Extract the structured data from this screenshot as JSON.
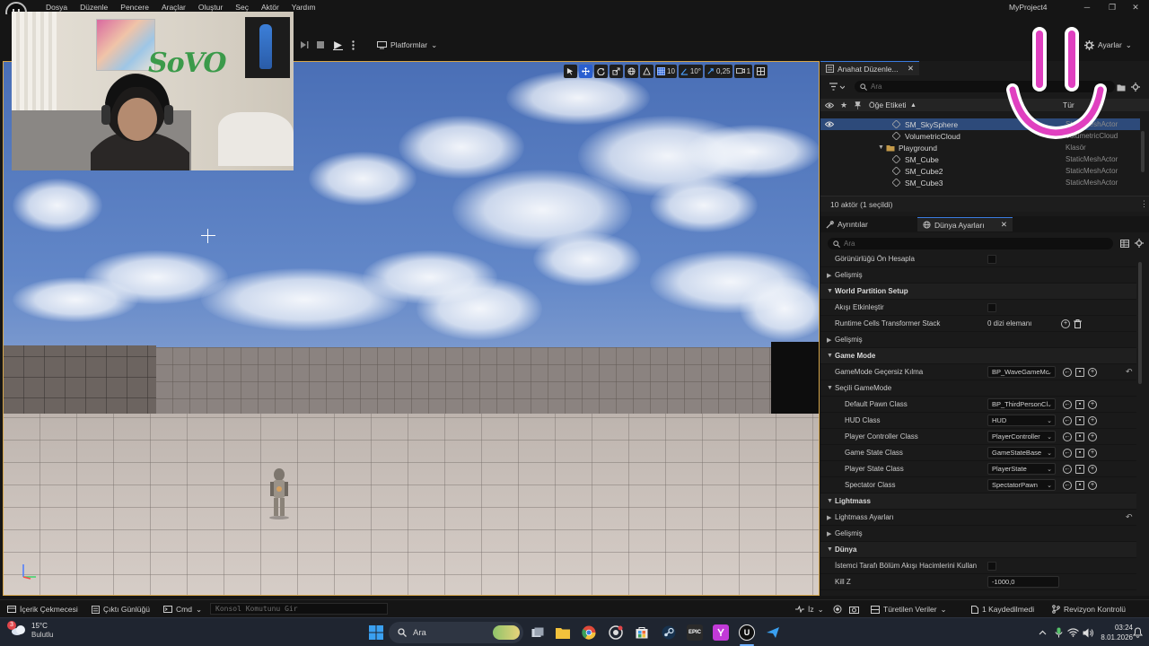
{
  "menu": {
    "logo": "U",
    "items": [
      "Dosya",
      "Düzenle",
      "Pencere",
      "Araçlar",
      "Oluştur",
      "Seç",
      "Aktör",
      "Yardım"
    ],
    "project_title": "MyProject4",
    "minimize": "─",
    "maximize": "❐",
    "close": "✕"
  },
  "toolbar": {
    "platforms_label": "Platformlar",
    "settings_label": "Ayarlar",
    "chevron": "⌄"
  },
  "viewport_toolbar": {
    "grid_snap_value": "10",
    "rotation_snap_value": "10°",
    "scale_snap_value": "0,25",
    "camera_speed_value": "1"
  },
  "webcam": {
    "graffiti_text": "SoVO"
  },
  "outliner": {
    "tab_label": "Anahat Düzenle...",
    "close_symbol": "✕",
    "search_placeholder": "Ara",
    "col_label": "Öğe Etiketi",
    "col_type": "Tür",
    "rows": [
      {
        "label": "SM_SkySphere",
        "type": "StaticMeshActor"
      },
      {
        "label": "VolumetricCloud",
        "type": "VolumetricCloud"
      },
      {
        "label": "Playground",
        "type": "Klasör"
      },
      {
        "label": "SM_Cube",
        "type": "StaticMeshActor"
      },
      {
        "label": "SM_Cube2",
        "type": "StaticMeshActor"
      },
      {
        "label": "SM_Cube3",
        "type": "StaticMeshActor"
      }
    ],
    "status": "10 aktör (1 seçildi)"
  },
  "details": {
    "tab_details": "Ayrıntılar",
    "tab_world_settings": "Dünya Ayarları",
    "close_symbol": "✕",
    "search_placeholder": "Ara",
    "rows": {
      "visibility_precompute": "Görünürlüğü Ön Hesapla",
      "advanced_1": "Gelişmiş",
      "world_partition_setup": "World Partition Setup",
      "enable_streaming": "Akışı Etkinleştir",
      "runtime_cells_transformer_stack": "Runtime Cells Transformer Stack",
      "array_elements_value": "0 dizi elemanı",
      "advanced_2": "Gelişmiş",
      "game_mode": "Game Mode",
      "gamemode_override": "GameMode Geçersiz Kılma",
      "gamemode_override_value": "BP_WaveGameMc",
      "selected_gamemode": "Seçili GameMode",
      "default_pawn_class": "Default Pawn Class",
      "default_pawn_value": "BP_ThirdPersonCl",
      "hud_class": "HUD Class",
      "hud_value": "HUD",
      "player_controller_class": "Player Controller Class",
      "player_controller_value": "PlayerController",
      "game_state_class": "Game State Class",
      "game_state_value": "GameStateBase",
      "player_state_class": "Player State Class",
      "player_state_value": "PlayerState",
      "spectator_class": "Spectator Class",
      "spectator_value": "SpectatorPawn",
      "lightmass": "Lightmass",
      "lightmass_settings": "Lightmass Ayarları",
      "advanced_3": "Gelişmiş",
      "world": "Dünya",
      "client_side_streaming": "İstemci Tarafı Bölüm Akışı Hacimlerini Kullan",
      "kill_z": "Kill Z",
      "kill_z_value": "-1000,0"
    }
  },
  "statusbar": {
    "content_drawer": "İçerik Çekmecesi",
    "output_log": "Çıktı Günlüğü",
    "cmd_label": "Cmd",
    "console_placeholder": "Konsol Komutunu Gir",
    "trace_label": "İz",
    "derived_data": "Türetilen Veriler",
    "unsaved": "1 Kaydedilmedi",
    "revision_control": "Revizyon Kontrolü"
  },
  "taskbar": {
    "temperature": "15°C",
    "weather_desc": "Bulutlu",
    "weather_badge": "3",
    "search_label": "Ara",
    "time": "03:24",
    "date": "8.01.2026"
  },
  "colors": {
    "accent_blue": "#2a5fd0",
    "selection_row": "#2d4a7a",
    "viewport_border": "#d6a64a",
    "smiley_pink": "#e040c0"
  }
}
